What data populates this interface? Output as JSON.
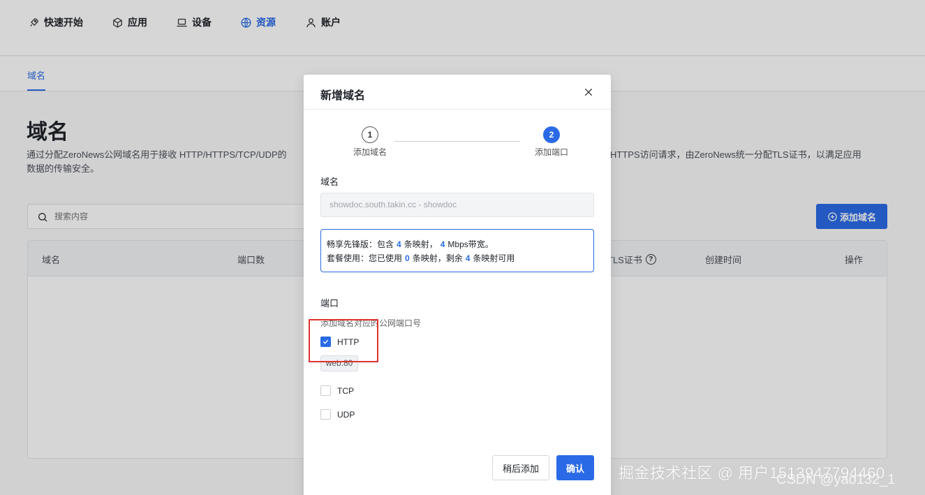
{
  "nav": {
    "items": [
      {
        "label": "快速开始",
        "icon": "rocket-icon"
      },
      {
        "label": "应用",
        "icon": "cube-icon"
      },
      {
        "label": "设备",
        "icon": "laptop-icon"
      },
      {
        "label": "资源",
        "icon": "globe-icon",
        "active": true
      },
      {
        "label": "账户",
        "icon": "user-icon"
      }
    ]
  },
  "subnav": {
    "tab": "域名"
  },
  "page": {
    "title": "域名",
    "description_left": "通过分配ZeroNews公网域名用于接收 HTTP/HTTPS/TCP/UDP的",
    "description_right": "HTTPS访问请求，由ZeroNews统一分配TLS证书，以满足应用",
    "description_line2": "数据的传输安全。",
    "search_placeholder": "搜索内容",
    "add_button": "添加域名",
    "table_headers": [
      "域名",
      "端口数",
      "TLS证书",
      "创建时间",
      "操作"
    ]
  },
  "modal": {
    "title": "新增域名",
    "steps": [
      {
        "number": "1",
        "label": "添加域名"
      },
      {
        "number": "2",
        "label": "添加端口"
      }
    ],
    "domain_label": "域名",
    "domain_value": "showdoc.south.takin.cc - showdoc",
    "info": {
      "plan_prefix": "畅享先锋版：包含",
      "mappings_total": "4",
      "mappings_unit": "条映射，",
      "bandwidth": "4",
      "bandwidth_unit": "Mbps带宽。",
      "usage_prefix": "套餐使用：您已使用",
      "used": "0",
      "used_unit": "条映射，剩余",
      "remaining": "4",
      "remaining_unit": "条映射可用"
    },
    "port_label": "端口",
    "port_hint": "添加域名对应的公网端口号",
    "ports": [
      {
        "label": "HTTP",
        "checked": true
      },
      {
        "label": "TCP",
        "checked": false
      },
      {
        "label": "UDP",
        "checked": false
      }
    ],
    "http_tag": "web:80",
    "later_button": "稍后添加",
    "confirm_button": "确认"
  },
  "watermark": {
    "text": "掘金技术社区 @ 用户1513947794460",
    "text2": "CSDN @yao132_1"
  },
  "colors": {
    "accent": "#2a6ae6",
    "highlight": "#e0322e"
  }
}
